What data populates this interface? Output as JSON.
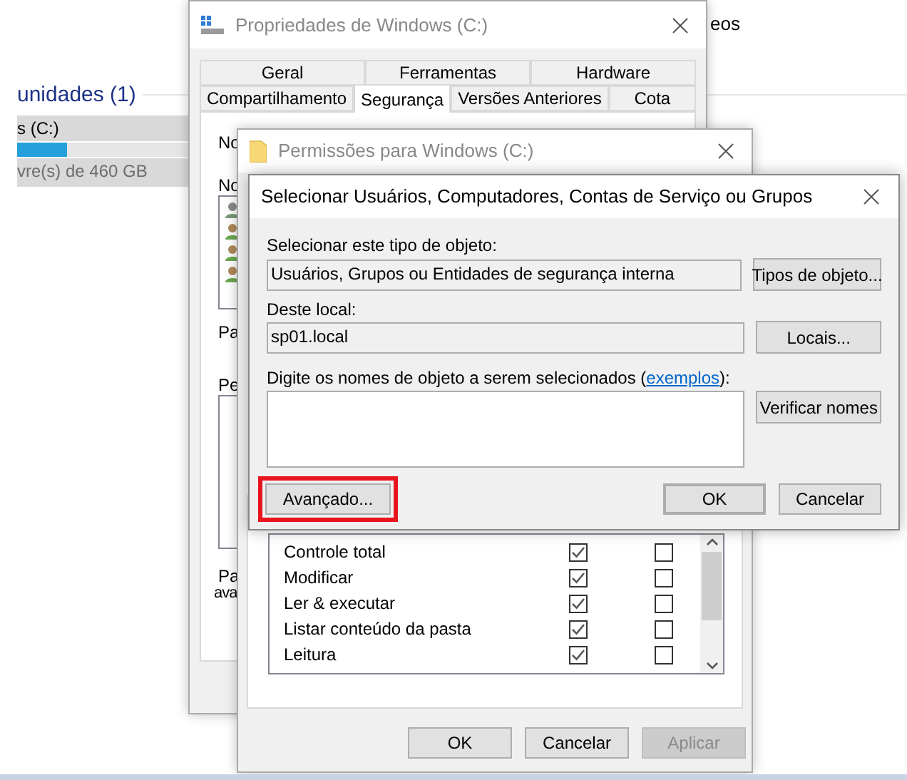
{
  "explorer": {
    "header_fragment": "eos",
    "section_title": "unidades (1)",
    "drive": {
      "name": "s (C:)",
      "level": 0.29,
      "free_text": "vre(s) de 460 GB"
    }
  },
  "properties_window": {
    "title": "Propriedades de Windows (C:)",
    "tab_rows": [
      [
        {
          "label": "Geral",
          "selected": false
        },
        {
          "label": "Ferramentas",
          "selected": false
        },
        {
          "label": "Hardware",
          "selected": false
        }
      ],
      [
        {
          "label": "Compartilhamento",
          "selected": false
        },
        {
          "label": "Segurança",
          "selected": true
        },
        {
          "label": "Versões Anteriores",
          "selected": false
        },
        {
          "label": "Cota",
          "selected": false
        }
      ]
    ],
    "label_fragments": [
      "No",
      "No",
      "Pa",
      "Pe"
    ],
    "note_fragments": [
      "Pa",
      "ava"
    ]
  },
  "permissions_window": {
    "title": "Permissões para Windows (C:)",
    "permissions": [
      {
        "name": "Controle total",
        "allow": true,
        "deny": false
      },
      {
        "name": "Modificar",
        "allow": true,
        "deny": false
      },
      {
        "name": "Ler & executar",
        "allow": true,
        "deny": false
      },
      {
        "name": "Listar conteúdo da pasta",
        "allow": true,
        "deny": false
      },
      {
        "name": "Leitura",
        "allow": true,
        "deny": false
      }
    ],
    "buttons": [
      {
        "label": "OK",
        "disabled": false
      },
      {
        "label": "Cancelar",
        "disabled": false
      },
      {
        "label": "Aplicar",
        "disabled": true
      }
    ]
  },
  "select_dialog": {
    "title": "Selecionar Usuários, Computadores, Contas de Serviço ou Grupos",
    "object_type_label": "Selecionar este tipo de objeto:",
    "object_type_value": "Usuários, Grupos ou Entidades de segurança interna",
    "object_type_button": "Tipos de objeto...",
    "location_label": "Deste local:",
    "location_value": "sp01.local",
    "location_button": "Locais...",
    "names_label_before": "Digite os nomes de objeto a serem selecionados (",
    "names_link": "exemplos",
    "names_label_after": "):",
    "check_button": "Verificar nomes",
    "advanced_button": {
      "label": "Avançado...",
      "highlighted": true
    },
    "ok_button": {
      "label": "OK",
      "default": true
    },
    "cancel_button": "Cancelar"
  }
}
